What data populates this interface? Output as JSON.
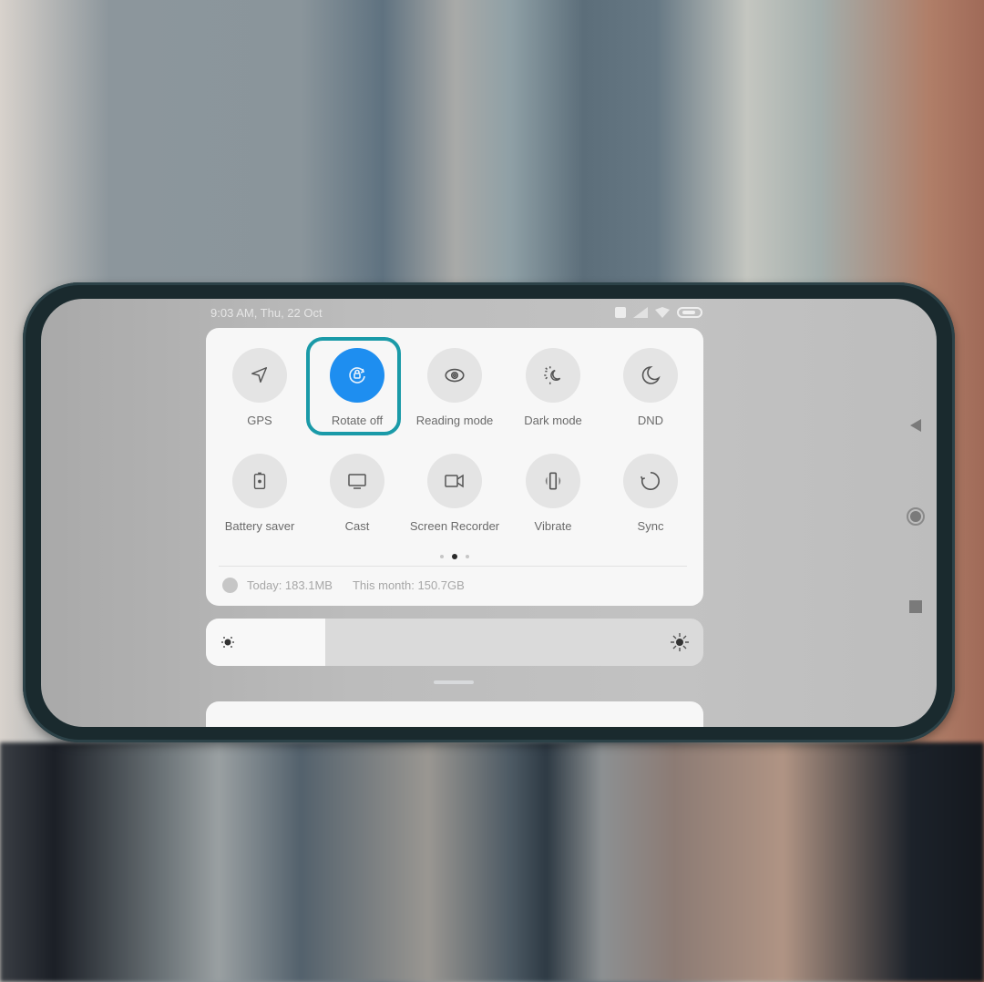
{
  "status_bar": {
    "time_date": "9:03 AM, Thu, 22 Oct",
    "icons": [
      "sim-icon",
      "signal-icon",
      "wifi-icon",
      "battery-icon"
    ]
  },
  "quick_settings": {
    "tiles": [
      {
        "label": "GPS",
        "icon": "location-arrow-icon",
        "active": false
      },
      {
        "label": "Rotate off",
        "icon": "rotation-lock-icon",
        "active": true
      },
      {
        "label": "Reading mode",
        "icon": "eye-icon",
        "active": false
      },
      {
        "label": "Dark mode",
        "icon": "sun-moon-icon",
        "active": false
      },
      {
        "label": "DND",
        "icon": "moon-icon",
        "active": false
      },
      {
        "label": "Battery saver",
        "icon": "battery-saver-icon",
        "active": false
      },
      {
        "label": "Cast",
        "icon": "monitor-icon",
        "active": false
      },
      {
        "label": "Screen Recorder",
        "icon": "video-camera-icon",
        "active": false
      },
      {
        "label": "Vibrate",
        "icon": "vibrate-icon",
        "active": false
      },
      {
        "label": "Sync",
        "icon": "sync-icon",
        "active": false
      }
    ],
    "highlighted_tile": "Rotate off",
    "page_indicator": {
      "pages": 3,
      "current": 2
    },
    "data_usage": {
      "today": "Today: 183.1MB",
      "month": "This month: 150.7GB"
    }
  },
  "brightness": {
    "level_fraction": 0.24
  },
  "navigation": {
    "buttons": [
      "back",
      "home",
      "recents"
    ]
  },
  "colors": {
    "active_tile": "#1e8ef0",
    "highlight_outline": "#1a9aa8",
    "panel_bg": "#f7f7f7"
  }
}
